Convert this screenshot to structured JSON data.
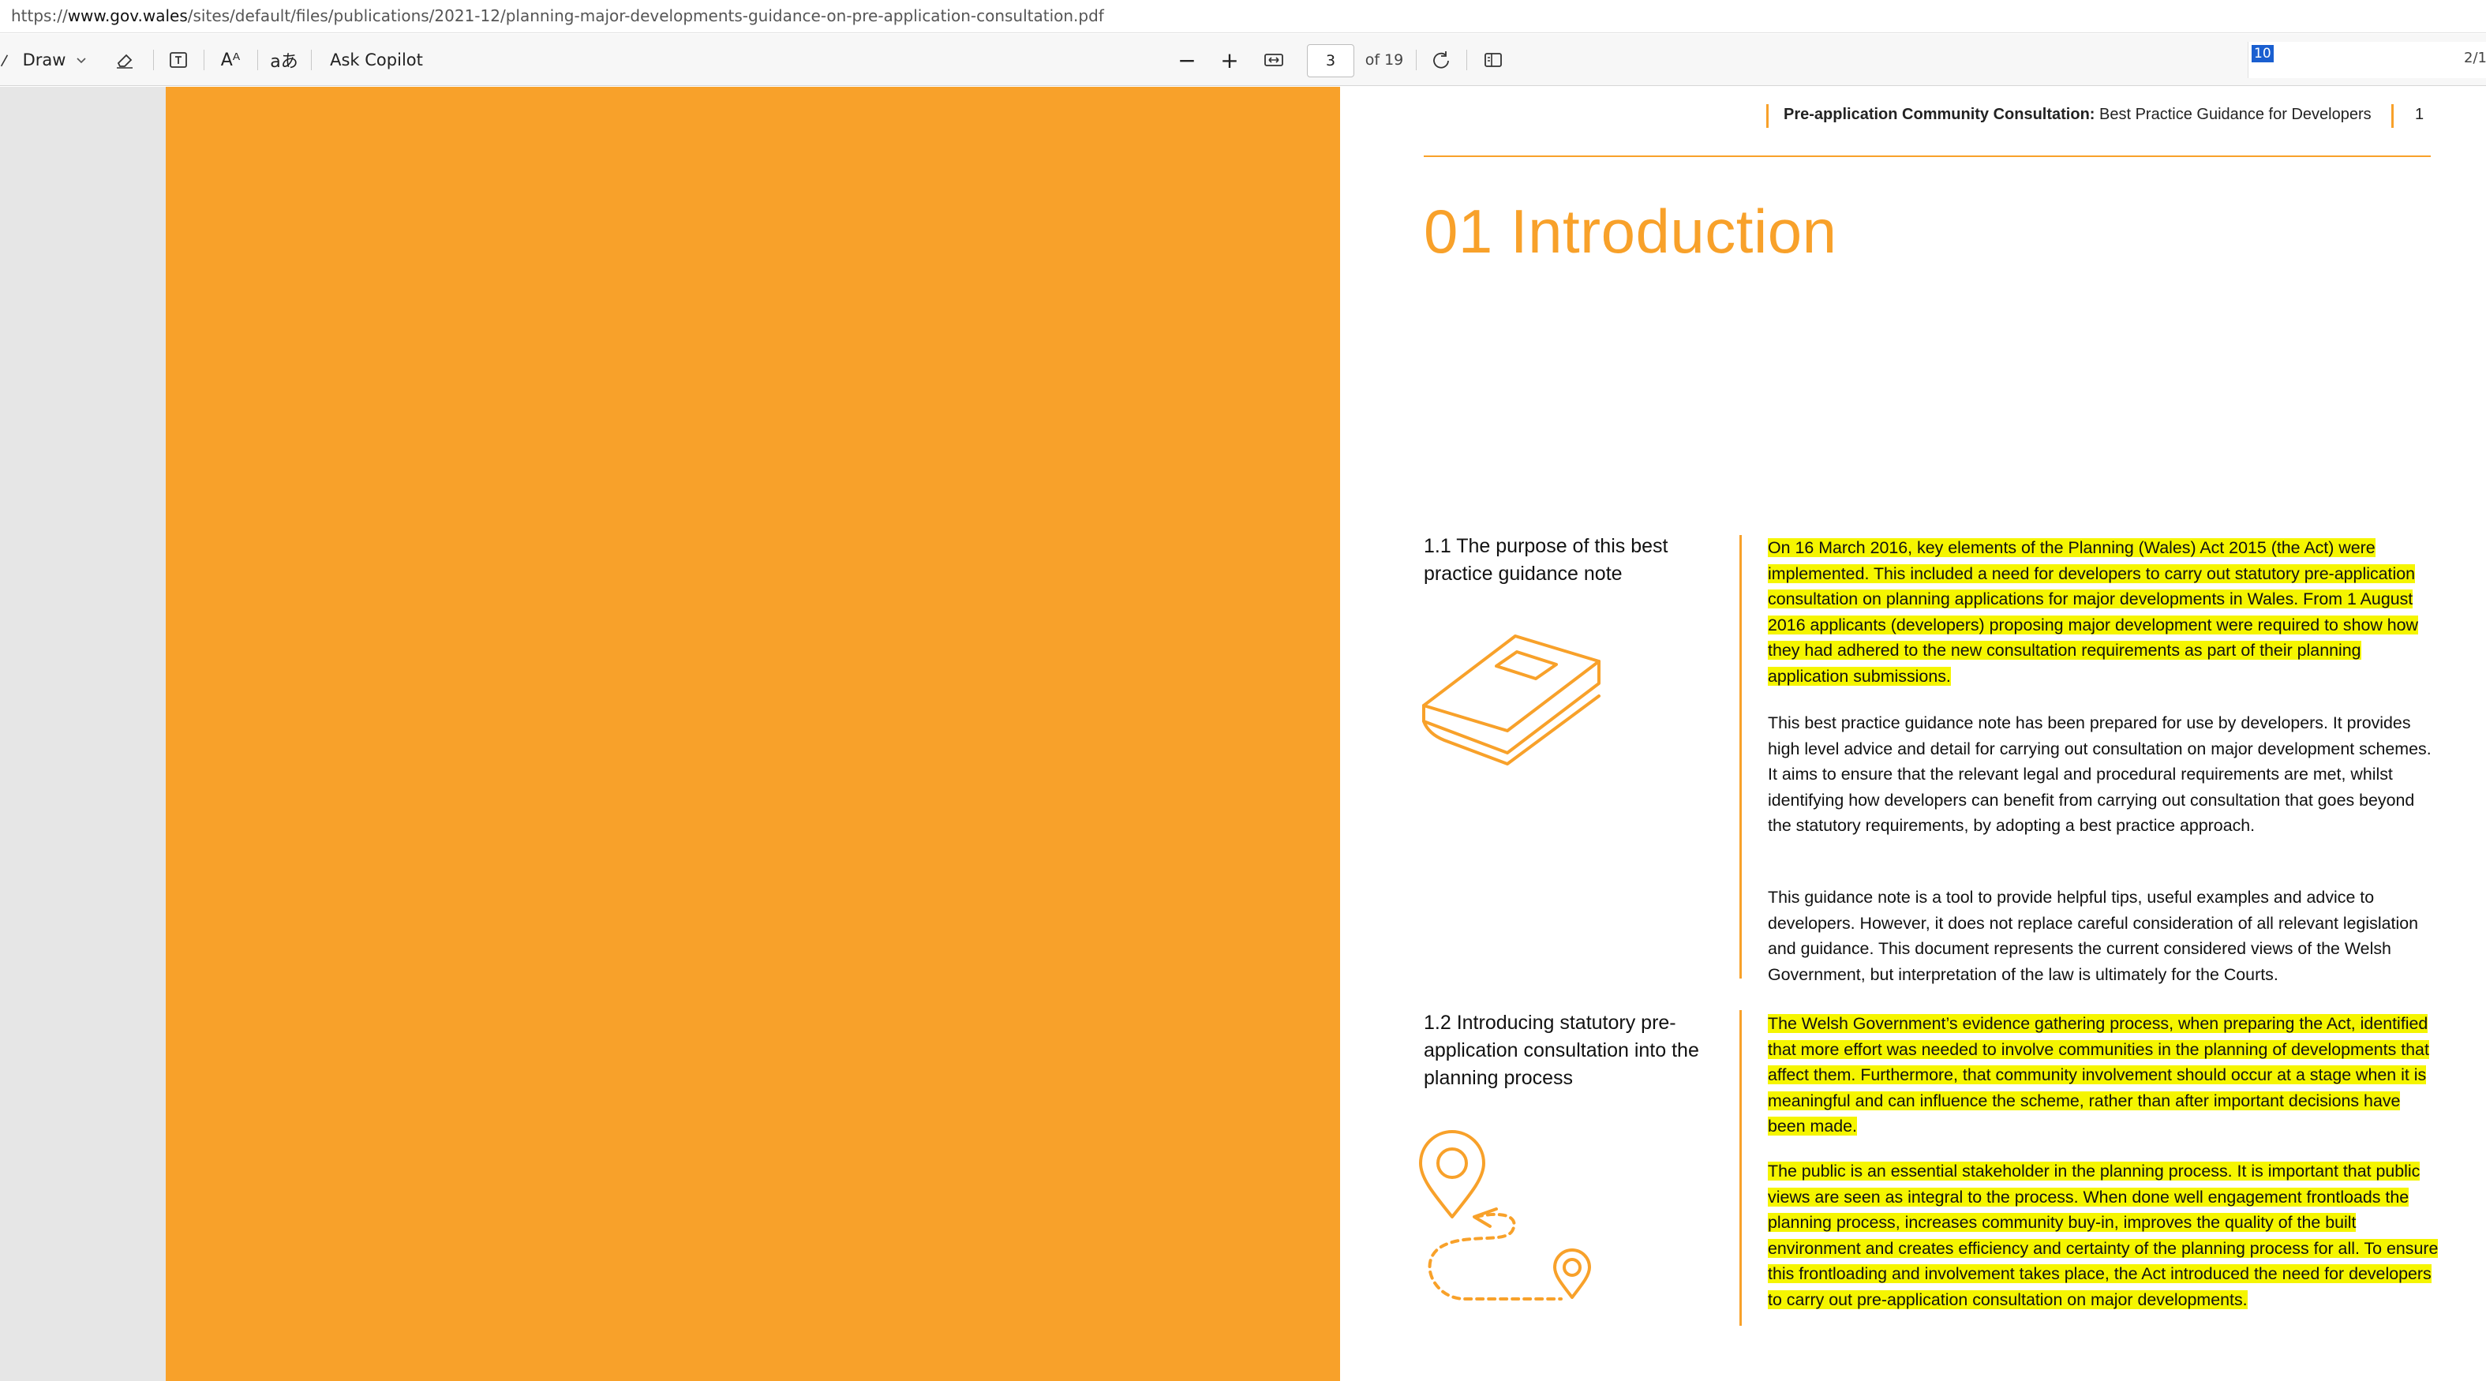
{
  "url": {
    "prefix": "https://",
    "domain": "www.gov.wales",
    "path": "/sites/default/files/publications/2021-12/planning-major-developments-guidance-on-pre-application-consultation.pdf"
  },
  "toolbar": {
    "draw_label": "Draw",
    "ask_copilot_label": "Ask Copilot",
    "page_current": "3",
    "page_total": "of 19",
    "search_value": "10",
    "search_count": "2/1",
    "zoom_out": "−",
    "zoom_in": "+",
    "read_aloud_glyph": "Aᴬ",
    "translate_glyph": "aあ"
  },
  "document": {
    "running_head_bold": "Pre-application Community Consultation:",
    "running_head_rest": " Best Practice Guidance for Developers",
    "page_number": "1",
    "title": "01 Introduction",
    "section1_heading": "1.1 The purpose of this best practice guidance note",
    "section1_para1": "On 16 March 2016, key elements of the Planning (Wales) Act 2015 (the Act) were implemented. This included a need for developers to carry out statutory pre-application consultation on planning applications for major developments in Wales. From 1 August 2016 applicants (developers) proposing major development were required to show how they had adhered to the new consultation requirements as part of their planning application submissions.",
    "section1_para2": "This best practice guidance note has been prepared for use by developers. It provides high level advice and detail for carrying out consultation on major development schemes. It aims to ensure that the relevant legal and procedural requirements are met, whilst identifying how developers can benefit from carrying out consultation that goes beyond the statutory requirements, by adopting a best practice approach.",
    "section1_para3": "This guidance note is a tool to provide helpful tips, useful examples and advice to developers. However, it does not replace careful consideration of all relevant legislation and guidance. This document represents the current considered views of the Welsh Government, but interpretation of the law is ultimately for the Courts.",
    "section2_heading": "1.2 Introducing statutory pre-application consultation into the planning process",
    "section2_para1": "The Welsh Government’s evidence gathering process, when preparing the Act, identified that more effort was needed to involve communities in the planning of developments that affect them. Furthermore, that community involvement should occur at a stage when it is meaningful and can influence the scheme, rather than after important decisions have been made.",
    "section2_para2": "The public is an essential stakeholder in the planning process. It is important that public views are seen as integral to the process. When done well engagement frontloads the planning process, increases community buy-in, improves the quality of the built environment and creates efficiency and certainty of the planning process for all. To ensure this frontloading and involvement takes place, the Act introduced the need for developers to carry out pre-application consultation on major developments."
  },
  "colors": {
    "accent_orange": "#f8a12a",
    "highlight_yellow": "#f5f500"
  },
  "icons": [
    "pen-icon",
    "chevron-down-icon",
    "eraser-icon",
    "text-box-icon",
    "read-aloud-icon",
    "translate-icon",
    "fit-width-icon",
    "rotate-icon",
    "page-view-icon",
    "book-icon",
    "route-pins-icon"
  ]
}
